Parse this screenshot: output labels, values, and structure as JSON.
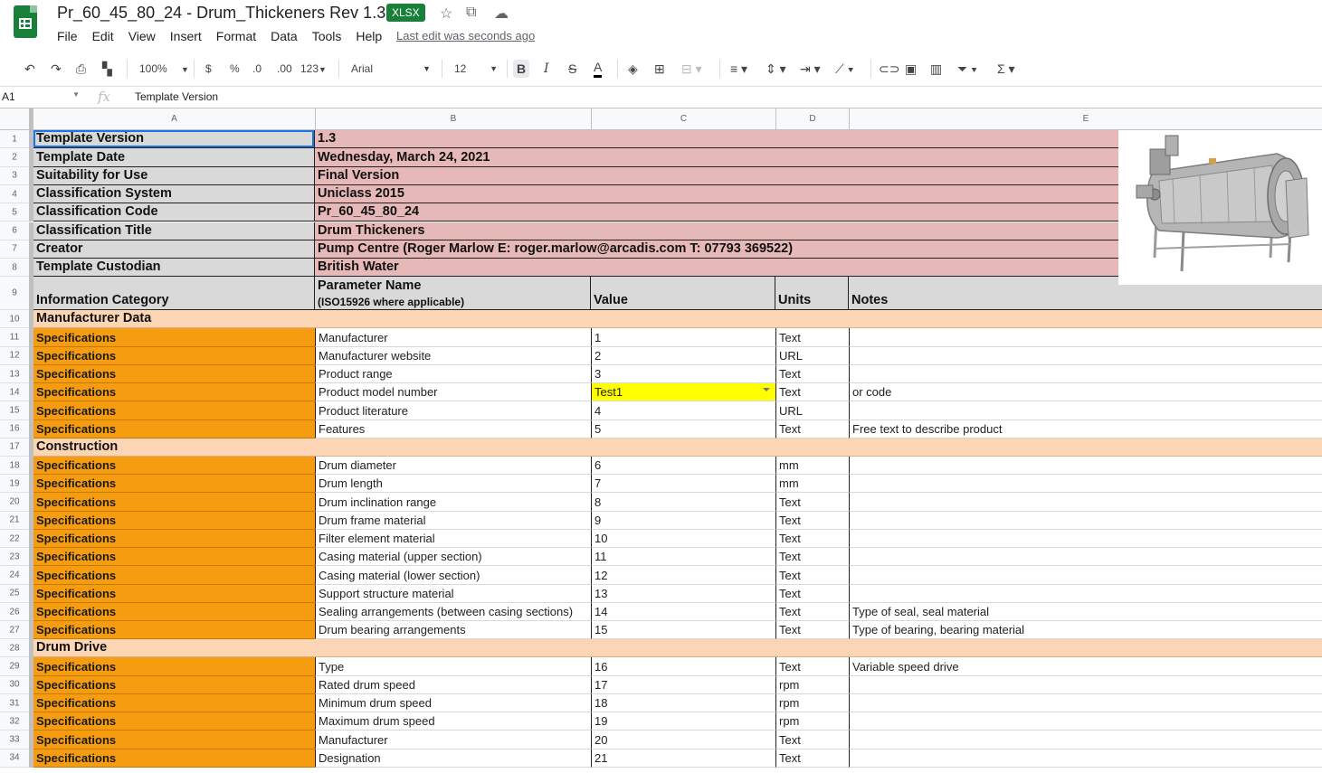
{
  "doc": {
    "title": "Pr_60_45_80_24 - Drum_Thickeners Rev 1.3",
    "badge": "XLSX",
    "last_edit": "Last edit was seconds ago"
  },
  "menu": [
    "File",
    "Edit",
    "View",
    "Insert",
    "Format",
    "Data",
    "Tools",
    "Help"
  ],
  "toolbar": {
    "zoom": "100%",
    "currency": "$",
    "percent": "%",
    "dec_decrease": ".0",
    "dec_increase": ".00",
    "more_formats": "123",
    "font": "Arial",
    "font_size": "12",
    "bold": "B",
    "italic": "I",
    "strike": "S",
    "text_color": "A"
  },
  "formula_bar": {
    "cell_ref": "A1",
    "fx": "fx",
    "value": "Template Version"
  },
  "columns": [
    "A",
    "B",
    "C",
    "D",
    "E"
  ],
  "meta_rows": [
    {
      "num": "1",
      "label": "Template Version",
      "value": "1.3"
    },
    {
      "num": "2",
      "label": "Template Date",
      "value": "Wednesday, March 24, 2021"
    },
    {
      "num": "3",
      "label": "Suitability for Use",
      "value": "Final Version"
    },
    {
      "num": "4",
      "label": "Classification System",
      "value": "Uniclass 2015"
    },
    {
      "num": "5",
      "label": "Classification Code",
      "value": "Pr_60_45_80_24"
    },
    {
      "num": "6",
      "label": "Classification Title",
      "value": "Drum Thickeners"
    },
    {
      "num": "7",
      "label": "Creator",
      "value": "Pump Centre (Roger Marlow E: roger.marlow@arcadis.com T: 07793 369522)"
    },
    {
      "num": "8",
      "label": "Template Custodian",
      "value": "British Water"
    }
  ],
  "header_row": {
    "num": "9",
    "info_category": "Information Category",
    "param_name": "Parameter Name",
    "param_sub": "(ISO15926 where applicable)",
    "value": "Value",
    "units": "Units",
    "notes": "Notes"
  },
  "data_rows": [
    {
      "num": "10",
      "type": "section",
      "label": "Manufacturer Data"
    },
    {
      "num": "11",
      "type": "spec",
      "category": "Specifications",
      "param": "Manufacturer",
      "value": "1",
      "units": "Text",
      "notes": ""
    },
    {
      "num": "12",
      "type": "spec",
      "category": "Specifications",
      "param": "Manufacturer website",
      "value": "2",
      "units": "URL",
      "notes": ""
    },
    {
      "num": "13",
      "type": "spec",
      "category": "Specifications",
      "param": "Product range",
      "value": "3",
      "units": "Text",
      "notes": ""
    },
    {
      "num": "14",
      "type": "spec",
      "category": "Specifications",
      "param": "Product model number",
      "value": "Test1",
      "units": "Text",
      "notes": "or code",
      "dropdown": true
    },
    {
      "num": "15",
      "type": "spec",
      "category": "Specifications",
      "param": "Product literature",
      "value": "4",
      "units": "URL",
      "notes": ""
    },
    {
      "num": "16",
      "type": "spec",
      "category": "Specifications",
      "param": "Features",
      "value": "5",
      "units": "Text",
      "notes": "Free text to describe product"
    },
    {
      "num": "17",
      "type": "section",
      "label": "Construction"
    },
    {
      "num": "18",
      "type": "spec",
      "category": "Specifications",
      "param": "Drum diameter",
      "value": "6",
      "units": "mm",
      "notes": ""
    },
    {
      "num": "19",
      "type": "spec",
      "category": "Specifications",
      "param": "Drum length",
      "value": "7",
      "units": "mm",
      "notes": ""
    },
    {
      "num": "20",
      "type": "spec",
      "category": "Specifications",
      "param": "Drum inclination range",
      "value": "8",
      "units": "Text",
      "notes": ""
    },
    {
      "num": "21",
      "type": "spec",
      "category": "Specifications",
      "param": "Drum frame material",
      "value": "9",
      "units": "Text",
      "notes": ""
    },
    {
      "num": "22",
      "type": "spec",
      "category": "Specifications",
      "param": "Filter element material",
      "value": "10",
      "units": "Text",
      "notes": ""
    },
    {
      "num": "23",
      "type": "spec",
      "category": "Specifications",
      "param": "Casing material (upper section)",
      "value": "11",
      "units": "Text",
      "notes": ""
    },
    {
      "num": "24",
      "type": "spec",
      "category": "Specifications",
      "param": "Casing material (lower section)",
      "value": "12",
      "units": "Text",
      "notes": ""
    },
    {
      "num": "25",
      "type": "spec",
      "category": "Specifications",
      "param": "Support structure material",
      "value": "13",
      "units": "Text",
      "notes": ""
    },
    {
      "num": "26",
      "type": "spec",
      "category": "Specifications",
      "param": "Sealing arrangements (between casing sections)",
      "value": "14",
      "units": "Text",
      "notes": "Type of seal, seal material"
    },
    {
      "num": "27",
      "type": "spec",
      "category": "Specifications",
      "param": "Drum bearing arrangements",
      "value": "15",
      "units": "Text",
      "notes": "Type of bearing, bearing material"
    },
    {
      "num": "28",
      "type": "section",
      "label": "Drum Drive"
    },
    {
      "num": "29",
      "type": "spec",
      "category": "Specifications",
      "param": "Type",
      "value": "16",
      "units": "Text",
      "notes": "Variable speed drive"
    },
    {
      "num": "30",
      "type": "spec",
      "category": "Specifications",
      "param": "Rated drum speed",
      "value": "17",
      "units": "rpm",
      "notes": ""
    },
    {
      "num": "31",
      "type": "spec",
      "category": "Specifications",
      "param": "Minimum drum speed",
      "value": "18",
      "units": "rpm",
      "notes": ""
    },
    {
      "num": "32",
      "type": "spec",
      "category": "Specifications",
      "param": "Maximum drum speed",
      "value": "19",
      "units": "rpm",
      "notes": ""
    },
    {
      "num": "33",
      "type": "spec",
      "category": "Specifications",
      "param": "Manufacturer",
      "value": "20",
      "units": "Text",
      "notes": ""
    },
    {
      "num": "34",
      "type": "spec",
      "category": "Specifications",
      "param": "Designation",
      "value": "21",
      "units": "Text",
      "notes": ""
    }
  ],
  "colors": {
    "spec": "#f59c10",
    "section": "#fcd5b4",
    "meta_label": "#d9d9d9",
    "meta_value": "#e6b8b7",
    "dropdown_cell": "#ffff00",
    "brand": "#188038"
  }
}
